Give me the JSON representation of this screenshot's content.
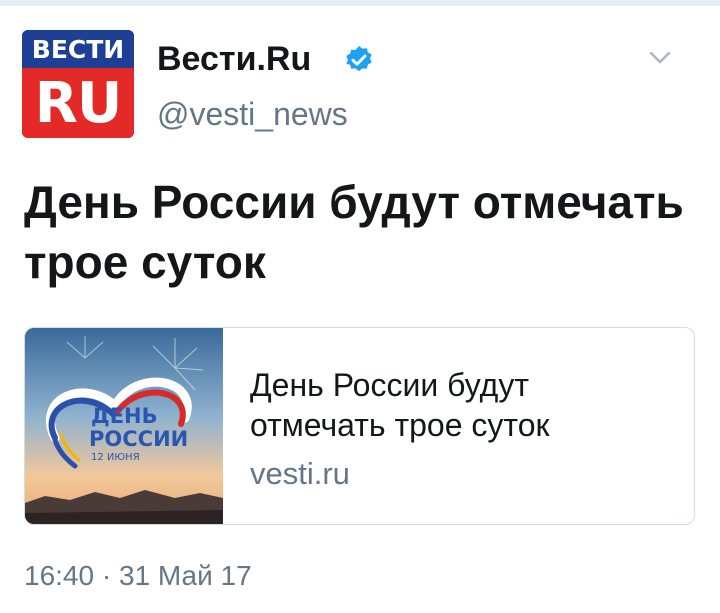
{
  "author": {
    "avatar_top_text": "ВЕСТИ",
    "avatar_bottom_text": "RU",
    "display_name": "Вести.Ru",
    "screen_name": "@vesti_news",
    "verified": true
  },
  "tweet": {
    "text": "День России будут отмечать трое суток",
    "timestamp": "16:40 · 31 Май 17"
  },
  "card": {
    "image_text_line1": "ДЕНЬ",
    "image_text_line2": "РОССИИ",
    "image_text_line3": "12 ИЮНЯ",
    "title": "День России будут отмечать трое суток",
    "domain": "vesti.ru"
  },
  "colors": {
    "accent_blue": "#1da1f2",
    "text_primary": "#14171a",
    "text_secondary": "#657786",
    "vesti_blue": "#1d3f94",
    "vesti_red": "#e32a26"
  },
  "icons": {
    "verified": "verified-badge-icon",
    "more": "chevron-down-icon"
  }
}
